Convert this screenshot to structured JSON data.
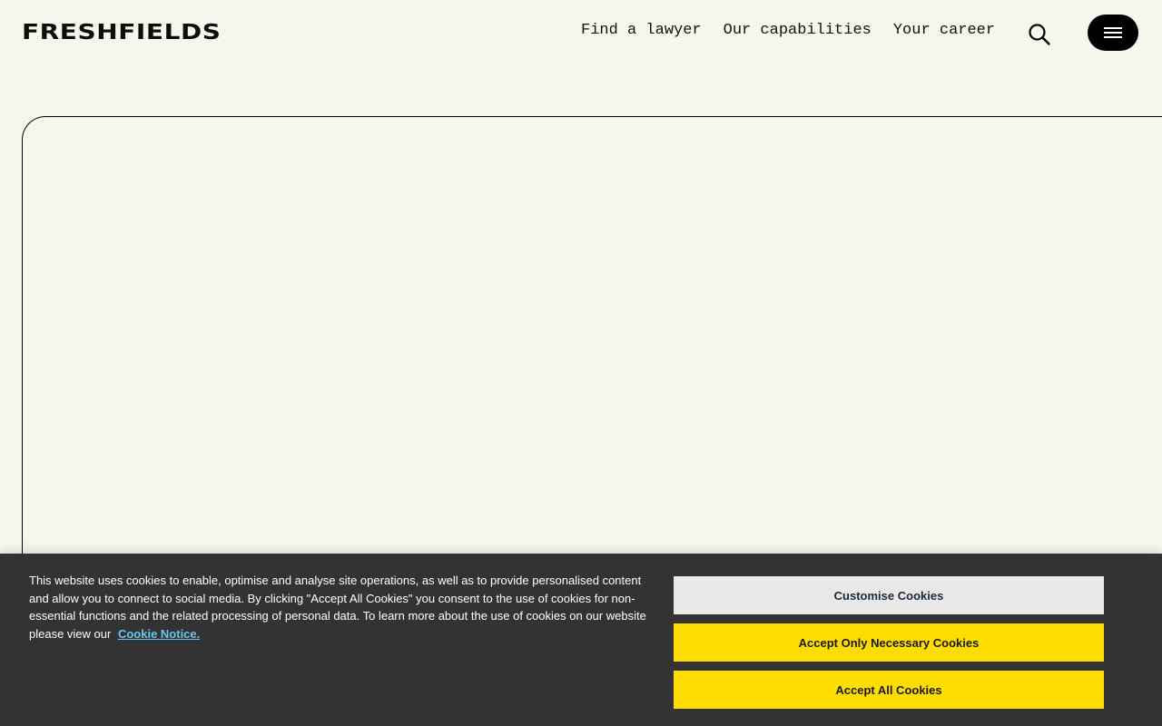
{
  "header": {
    "logo_text": "FRESHFIELDS",
    "nav": [
      {
        "label": "Find a lawyer"
      },
      {
        "label": "Our capabilities"
      },
      {
        "label": "Your career"
      }
    ],
    "search_icon": "search-icon",
    "menu_icon": "hamburger-menu-icon"
  },
  "cookie_banner": {
    "text": "This website uses cookies to enable, optimise and analyse site operations, as well as to provide personalised content and allow you to connect to social media. By clicking \"Accept All Cookies\" you consent to the use of cookies for non-essential functions and the related processing of personal data. To learn more about the use of cookies on our website please view our",
    "link_label": "Cookie Notice.",
    "buttons": {
      "customise": "Customise Cookies",
      "necessary": "Accept Only Necessary Cookies",
      "accept_all": "Accept All Cookies"
    }
  },
  "colors": {
    "page_background": "#f7f6ec",
    "banner_background": "#333333",
    "accent_yellow": "#ffdd00",
    "link_blue": "#69c6f0"
  }
}
